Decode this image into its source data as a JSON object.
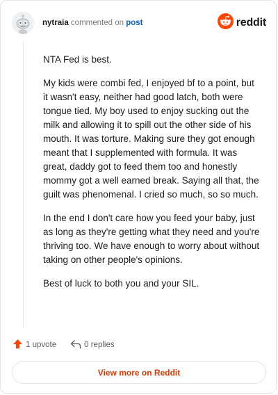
{
  "header": {
    "username": "nytraia",
    "action_text": "commented on",
    "post_link": "post",
    "brand": "reddit"
  },
  "comment": {
    "paragraphs": [
      "NTA Fed is best.",
      "My kids were combi fed, I enjoyed bf to a point, but it wasn't easy, neither had good latch, both were tongue tied. My boy used to enjoy sucking out the milk and allowing it to spill out the other side of his mouth. It was torture. Making sure they got enough meant that I supplemented with formula. It was great, daddy got to feed them too and honestly mommy got a well earned break. Saying all that, the guilt was phenomenal. I cried so much, so so much.",
      "In the end I don't care how you feed your baby, just as long as they're getting what they need and you're thriving too. We have enough to worry about without taking on other people's opinions.",
      "Best of luck to both you and your SIL."
    ]
  },
  "actions": {
    "upvote_label": "1 upvote",
    "replies_label": "0 replies"
  },
  "footer": {
    "view_more_label": "View more on Reddit"
  },
  "colors": {
    "brand_orange": "#FF4500",
    "upvote_orange": "#FF4500",
    "link_blue": "#0A63C9",
    "button_text": "#D93A00"
  },
  "icons": {
    "avatar": "snoo-avatar-icon",
    "brand": "reddit-logo-icon",
    "upvote": "upvote-arrow-icon",
    "reply": "reply-arrow-icon"
  }
}
